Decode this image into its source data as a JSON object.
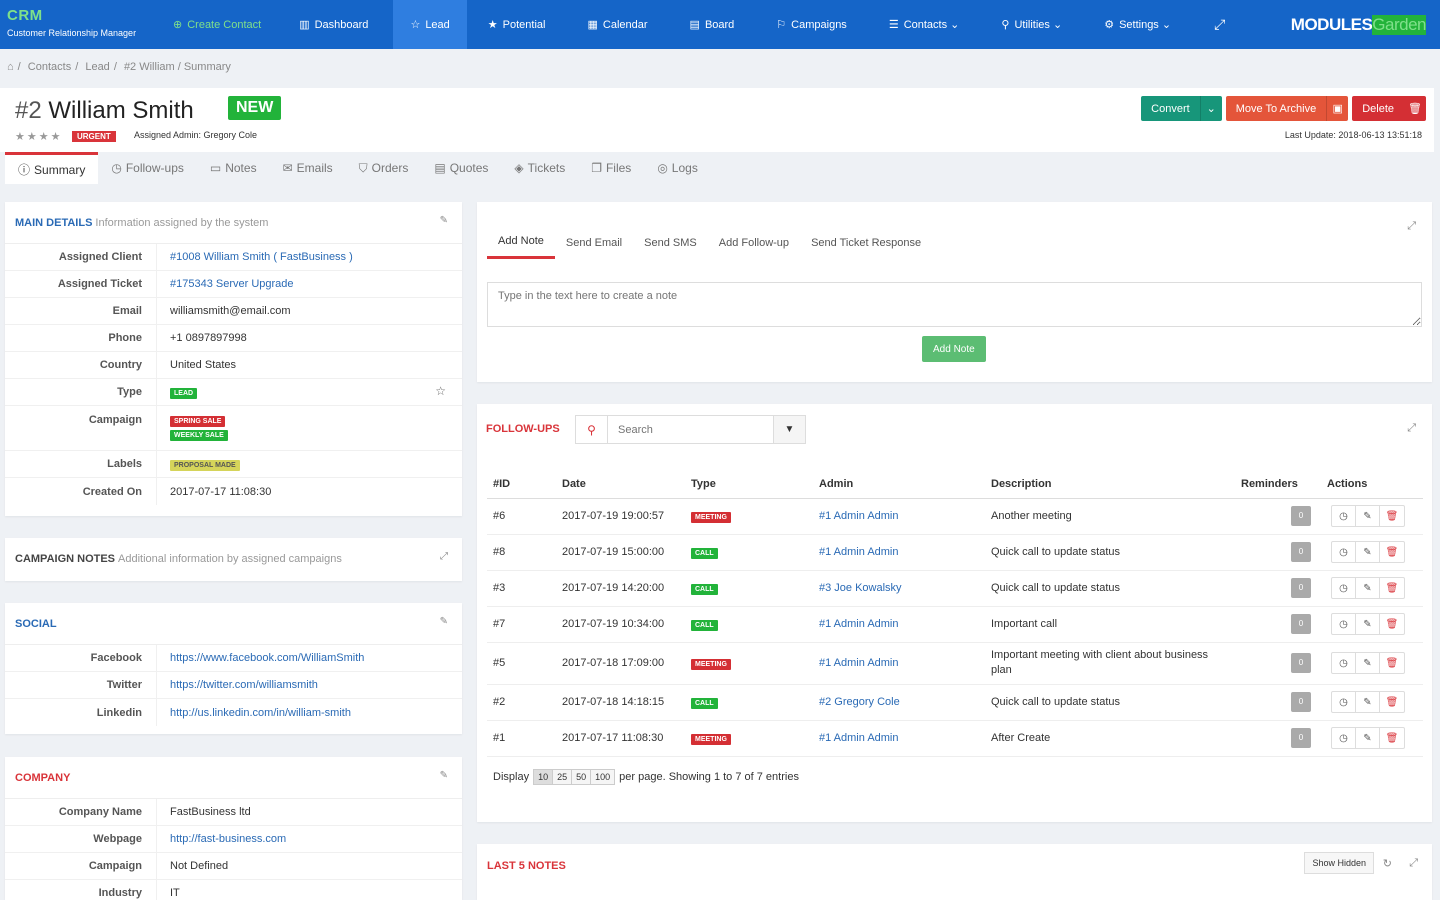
{
  "nav": {
    "brand_title": "CRM",
    "brand_sub": "Customer Relationship Manager",
    "items": [
      {
        "label": "Create Contact",
        "icon": "⊕"
      },
      {
        "label": "Dashboard",
        "icon": "▥"
      },
      {
        "label": "Lead",
        "icon": "☆"
      },
      {
        "label": "Potential",
        "icon": "★"
      },
      {
        "label": "Calendar",
        "icon": "▦"
      },
      {
        "label": "Board",
        "icon": "▤"
      },
      {
        "label": "Campaigns",
        "icon": "⚐"
      },
      {
        "label": "Contacts",
        "icon": "☰"
      },
      {
        "label": "Utilities",
        "icon": "⚲"
      },
      {
        "label": "Settings",
        "icon": "⚙"
      }
    ],
    "logo_a": "MODULES",
    "logo_b": "Garden"
  },
  "breadcrumb": [
    "Contacts",
    "Lead",
    "#2 William / Summary"
  ],
  "header": {
    "num": "#2",
    "name": "William Smith",
    "status": "NEW",
    "priority": "URGENT",
    "assigned": "Assigned Admin: Gregory Cole",
    "convert": "Convert",
    "archive": "Move To Archive",
    "delete": "Delete",
    "last_update": "Last Update: 2018-06-13 13:51:18"
  },
  "tabs": [
    "Summary",
    "Follow-ups",
    "Notes",
    "Emails",
    "Orders",
    "Quotes",
    "Tickets",
    "Files",
    "Logs"
  ],
  "main": {
    "title": "MAIN DETAILS",
    "sub": "Information assigned by the system",
    "assigned_client_k": "Assigned Client",
    "assigned_client_v": "#1008 William Smith ( FastBusiness )",
    "assigned_ticket_k": "Assigned Ticket",
    "assigned_ticket_v": "#175343 Server Upgrade",
    "email_k": "Email",
    "email_v": "williamsmith@email.com",
    "phone_k": "Phone",
    "phone_v": "+1 0897897998",
    "country_k": "Country",
    "country_v": "United States",
    "type_k": "Type",
    "type_v": "LEAD",
    "campaign_k": "Campaign",
    "campaign_v1": "SPRING SALE",
    "campaign_v2": "WEEKLY SALE",
    "labels_k": "Labels",
    "labels_v": "PROPOSAL MADE",
    "created_k": "Created On",
    "created_v": "2017-07-17 11:08:30"
  },
  "campaign_notes": {
    "title": "CAMPAIGN NOTES",
    "sub": "Additional information by assigned campaigns"
  },
  "social": {
    "title": "SOCIAL",
    "fb_k": "Facebook",
    "fb_v": "https://www.facebook.com/WilliamSmith",
    "tw_k": "Twitter",
    "tw_v": "https://twitter.com/williamsmith",
    "li_k": "Linkedin",
    "li_v": "http://us.linkedin.com/in/william-smith"
  },
  "company": {
    "title": "COMPANY",
    "name_k": "Company Name",
    "name_v": "FastBusiness ltd",
    "web_k": "Webpage",
    "web_v": "http://fast-business.com",
    "camp_k": "Campaign",
    "camp_v": "Not Defined",
    "ind_k": "Industry",
    "ind_v": "IT"
  },
  "notes": {
    "tabs": [
      "Add Note",
      "Send Email",
      "Send SMS",
      "Add Follow-up",
      "Send Ticket Response"
    ],
    "placeholder": "Type in the text here to create a note",
    "button": "Add Note"
  },
  "followups": {
    "title": "FOLLOW-UPS",
    "search_placeholder": "Search",
    "columns": [
      "#ID",
      "Date",
      "Type",
      "Admin",
      "Description",
      "Reminders",
      "Actions"
    ],
    "rows": [
      {
        "id": "#6",
        "date": "2017-07-19 19:00:57",
        "type": "MEETING",
        "admin": "#1 Admin Admin",
        "desc": "Another meeting",
        "rem": "0"
      },
      {
        "id": "#8",
        "date": "2017-07-19 15:00:00",
        "type": "CALL",
        "admin": "#1 Admin Admin",
        "desc": "Quick call to update status",
        "rem": "0"
      },
      {
        "id": "#3",
        "date": "2017-07-19 14:20:00",
        "type": "CALL",
        "admin": "#3 Joe Kowalsky",
        "desc": "Quick call to update status",
        "rem": "0"
      },
      {
        "id": "#7",
        "date": "2017-07-19 10:34:00",
        "type": "CALL",
        "admin": "#1 Admin Admin",
        "desc": "Important call",
        "rem": "0"
      },
      {
        "id": "#5",
        "date": "2017-07-18 17:09:00",
        "type": "MEETING",
        "admin": "#1 Admin Admin",
        "desc": "Important meeting with client about business plan",
        "rem": "0"
      },
      {
        "id": "#2",
        "date": "2017-07-18 14:18:15",
        "type": "CALL",
        "admin": "#2 Gregory Cole",
        "desc": "Quick call to update status",
        "rem": "0"
      },
      {
        "id": "#1",
        "date": "2017-07-17 11:08:30",
        "type": "MEETING",
        "admin": "#1 Admin Admin",
        "desc": "After Create",
        "rem": "0"
      }
    ],
    "display": "Display",
    "page_sizes": [
      "10",
      "25",
      "50",
      "100"
    ],
    "per_page": "per page. Showing 1 to 7 of 7 entries"
  },
  "last_notes": {
    "title": "LAST 5 NOTES",
    "show_hidden": "Show Hidden"
  }
}
